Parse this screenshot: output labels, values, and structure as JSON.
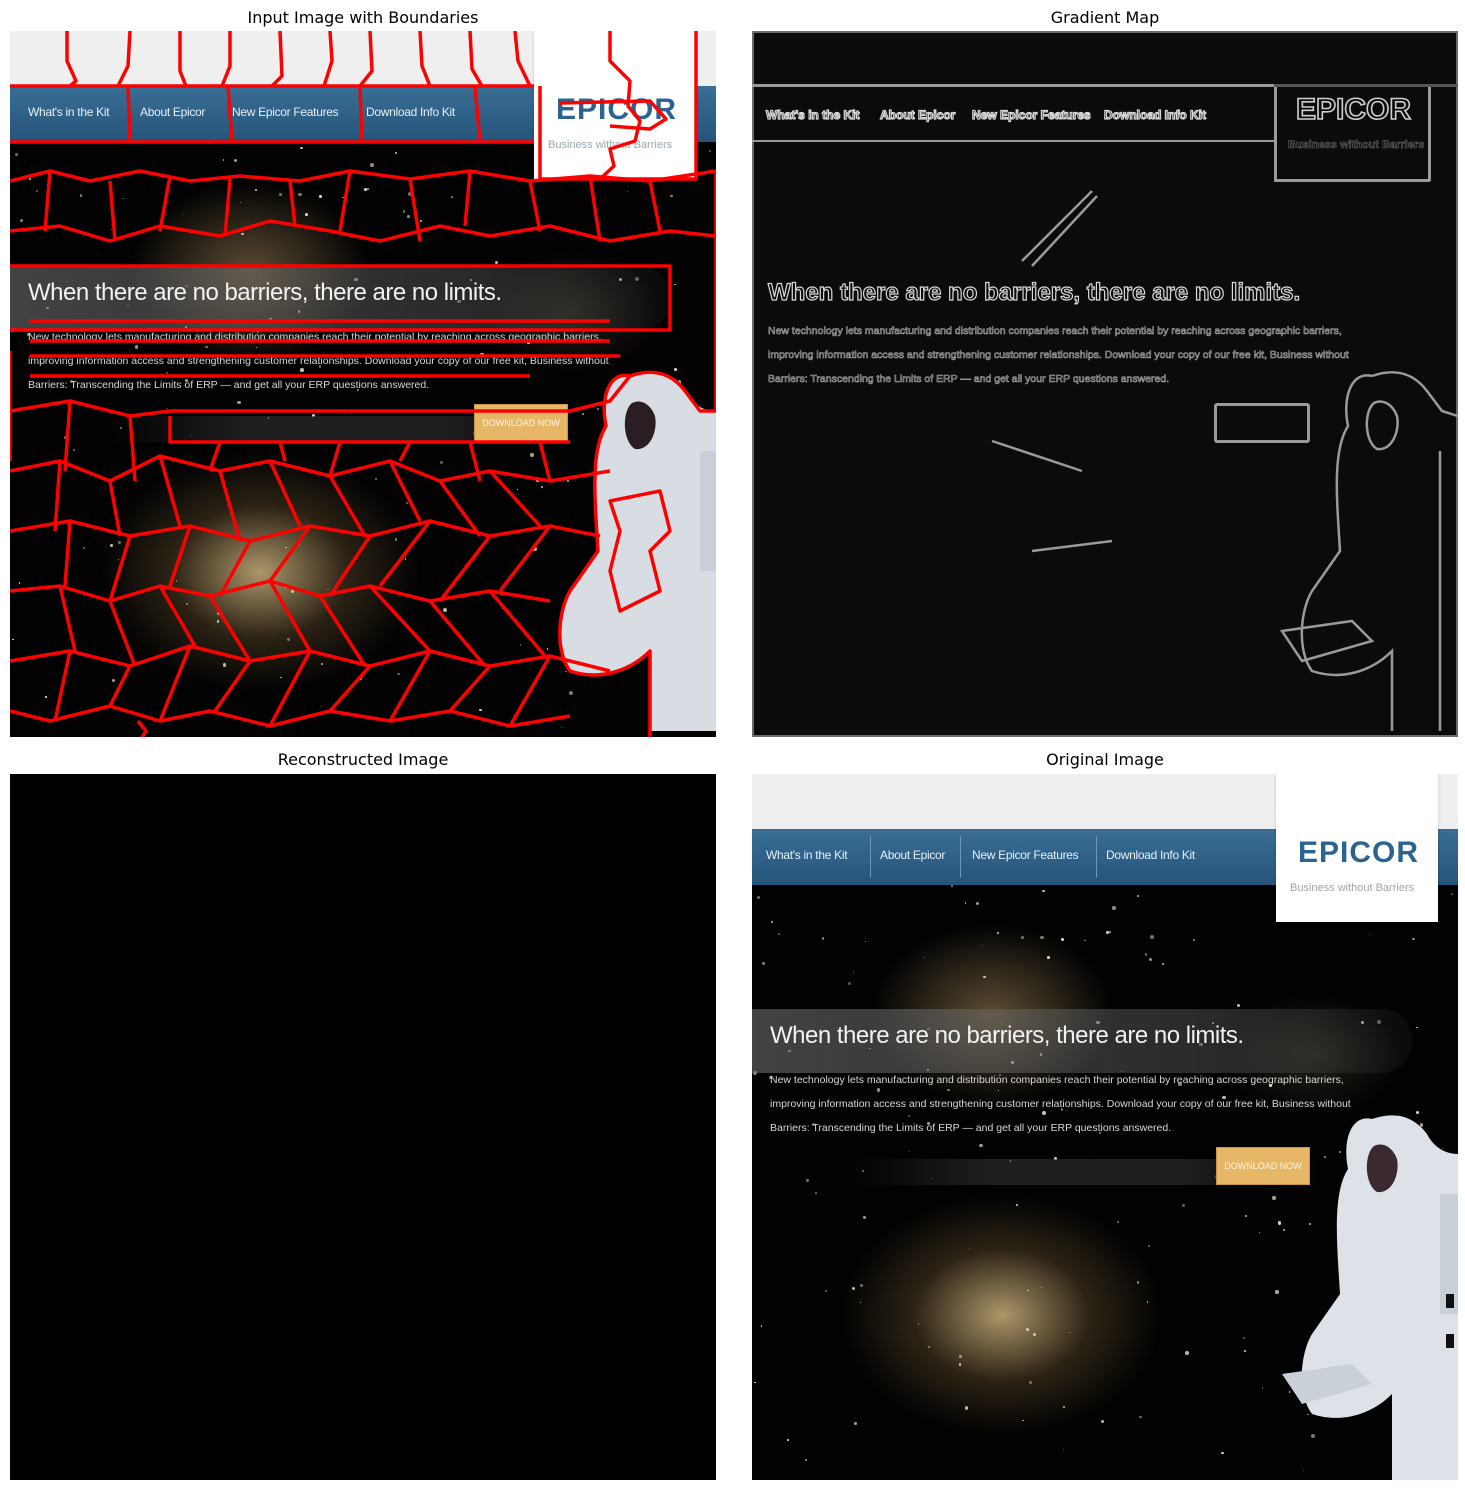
{
  "panels": {
    "boundaries": "Input Image with Boundaries",
    "gradient": "Gradient Map",
    "reconstructed": "Reconstructed Image",
    "original": "Original Image"
  },
  "site": {
    "nav": [
      "What's in the Kit",
      "About Epicor",
      "New Epicor Features",
      "Download Info Kit"
    ],
    "logo": "EPICOR",
    "tagline": "Business without Barriers",
    "headline": "When there are no barriers, there are no limits.",
    "body": "New technology lets manufacturing and distribution companies reach their potential by reaching across geographic barriers, improving information access and strengthening customer relationships. Download your copy of our free kit, Business without Barriers: Transcending the Limits of ERP — and get all your ERP questions answered.",
    "cta": "DOWNLOAD NOW"
  },
  "colors": {
    "boundary": "#ff0000",
    "nav": "#2f6388",
    "cta": "#e7b768",
    "logo": "#2d6391"
  }
}
